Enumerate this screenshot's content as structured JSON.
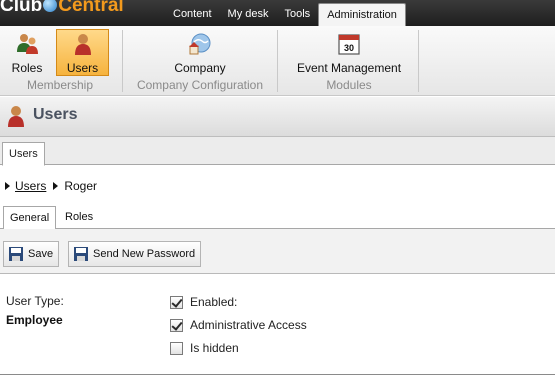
{
  "app": {
    "logo_left": "Club",
    "logo_right": "Central"
  },
  "top_tabs": [
    {
      "label": "Content",
      "active": false
    },
    {
      "label": "My desk",
      "active": false
    },
    {
      "label": "Tools",
      "active": false
    },
    {
      "label": "Administration",
      "active": true
    }
  ],
  "ribbon": {
    "groups": [
      {
        "title": "Membership",
        "buttons": [
          {
            "label": "Roles",
            "icon": "roles-icon"
          },
          {
            "label": "Users",
            "icon": "users-icon",
            "active": true
          }
        ]
      },
      {
        "title": "Company Configuration",
        "buttons": [
          {
            "label": "Company",
            "icon": "company-globe-icon"
          }
        ]
      },
      {
        "title": "Modules",
        "buttons": [
          {
            "label": "Event Management",
            "icon": "calendar-icon",
            "calendar_day": "30"
          }
        ]
      }
    ]
  },
  "page": {
    "title": "Users",
    "icon": "user-icon"
  },
  "object_tab": {
    "label": "Users"
  },
  "breadcrumb": {
    "parent": "Users",
    "current": "Roger"
  },
  "sub_tabs": [
    {
      "label": "General",
      "active": true
    },
    {
      "label": "Roles",
      "active": false
    }
  ],
  "actions": {
    "save_label": "Save",
    "send_password_label": "Send New Password"
  },
  "form": {
    "user_type_label": "User Type:",
    "user_type_value": "Employee",
    "enabled": {
      "label": "Enabled:",
      "checked": true
    },
    "admin_access": {
      "label": "Administrative Access",
      "checked": true
    },
    "is_hidden": {
      "label": "Is hidden",
      "checked": false
    }
  },
  "colors": {
    "header_bg": "#2a2a2a",
    "accent_orange": "#f39a1d",
    "active_ribbon": "#f6b33e",
    "title_text": "#4a5260"
  }
}
